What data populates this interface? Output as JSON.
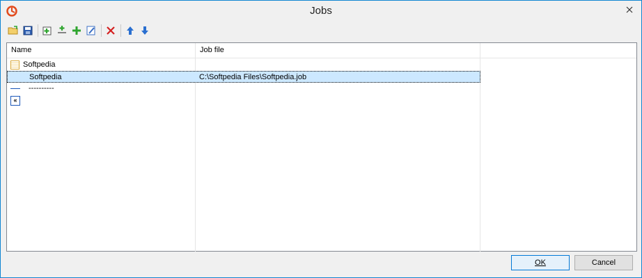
{
  "window": {
    "title": "Jobs"
  },
  "toolbar": {
    "buttons": [
      {
        "name": "open-icon",
        "color": "#d9a020"
      },
      {
        "name": "save-icon",
        "color": "#1f4f9e"
      },
      {
        "name": "add-job-icon",
        "color": "#2fa52f"
      },
      {
        "name": "insert-icon",
        "color": "#2fa52f"
      },
      {
        "name": "add-icon",
        "color": "#2fa52f"
      },
      {
        "name": "edit-icon",
        "color": "#3b6fc4"
      },
      {
        "name": "delete-icon",
        "color": "#d42020"
      },
      {
        "name": "move-up-icon",
        "color": "#2a6fd0"
      },
      {
        "name": "move-down-icon",
        "color": "#2a6fd0"
      }
    ]
  },
  "list": {
    "columns": [
      "Name",
      "Job file"
    ],
    "rows": [
      {
        "name": "Softpedia",
        "job_file": "",
        "type": "folder"
      },
      {
        "name": "Softpedia",
        "job_file": "C:\\Softpedia Files\\Softpedia.job",
        "type": "job",
        "selected": true
      },
      {
        "name": "----------",
        "job_file": "",
        "type": "separator"
      },
      {
        "name": "«",
        "job_file": "",
        "type": "back"
      }
    ]
  },
  "buttons": {
    "ok_label": "OK",
    "cancel_label": "Cancel"
  }
}
